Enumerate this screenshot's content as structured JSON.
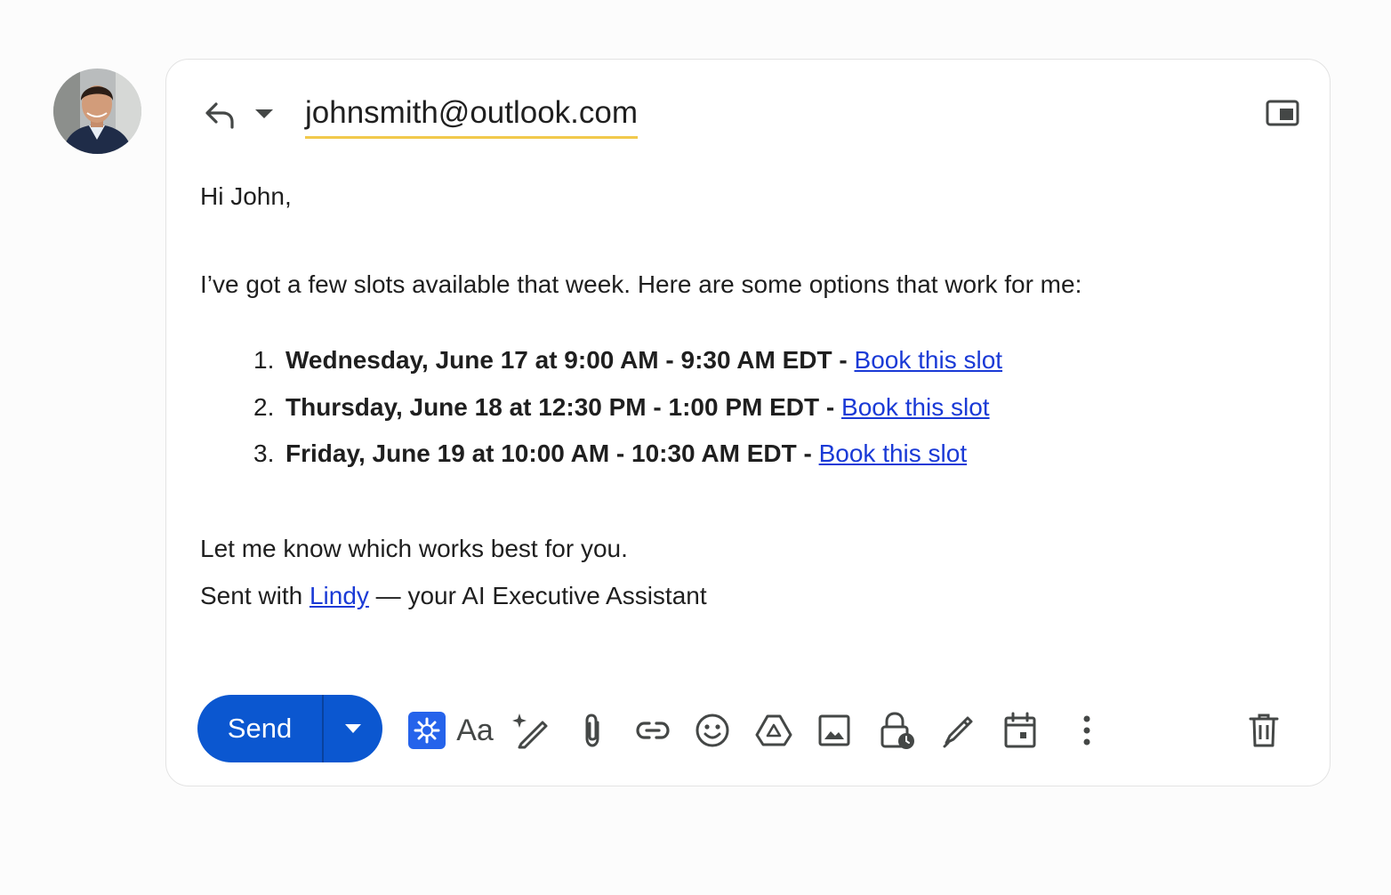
{
  "compose": {
    "recipient": "johnsmith@outlook.com",
    "greeting": "Hi John,",
    "intro": "I’ve got a few slots available that week. Here are some options that work for me:",
    "slots": [
      {
        "num": "1.",
        "time": "Wednesday, June 17 at 9:00 AM - 9:30 AM EDT",
        "sep": " - ",
        "link": "Book this slot"
      },
      {
        "num": "2.",
        "time": "Thursday, June 18 at 12:30 PM - 1:00 PM EDT",
        "sep": " - ",
        "link": "Book this slot"
      },
      {
        "num": "3.",
        "time": "Friday, June 19 at 10:00 AM - 10:30 AM EDT",
        "sep": " - ",
        "link": "Book this slot"
      }
    ],
    "closing": "Let me know which works best for you.",
    "signature": {
      "prefix": "Sent with ",
      "link": "Lindy",
      "suffix": " — your AI Executive Assistant"
    }
  },
  "toolbar": {
    "send_label": "Send",
    "format_label": "Aa",
    "icons": [
      "lindy-icon",
      "text-format-icon",
      "magic-pen-icon",
      "attach-icon",
      "link-icon",
      "emoji-icon",
      "drive-icon",
      "image-icon",
      "confidential-lock-icon",
      "signature-pen-icon",
      "calendar-icon",
      "more-options-icon",
      "trash-icon"
    ]
  },
  "colors": {
    "send_button": "#0b57d0",
    "link": "#1a3ad6",
    "recipient_underline": "#f2c94c",
    "lindy_badge": "#2563eb"
  }
}
